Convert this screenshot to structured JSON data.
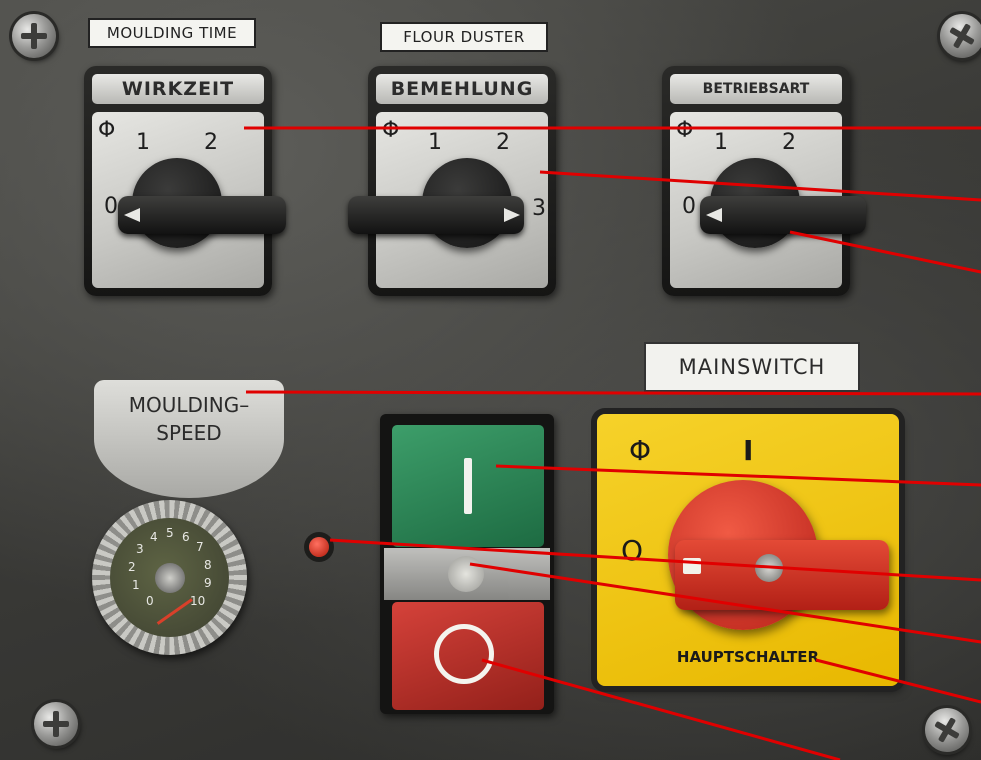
{
  "labels": {
    "moulding_time": "MOULDING TIME",
    "flour_duster": "FLOUR DUSTER"
  },
  "switches": [
    {
      "name": "WIRKZEIT",
      "phase": "Φ",
      "p0": "0",
      "p1": "1",
      "p2": "2"
    },
    {
      "name": "BEMEHLUNG",
      "phase": "Φ",
      "p1": "1",
      "p2": "2",
      "p3": "3"
    },
    {
      "name": "BETRIEBSART",
      "phase": "Φ",
      "p0": "0",
      "p1": "1",
      "p2": "2"
    }
  ],
  "moulding_speed": {
    "line1": "MOULDING–",
    "line2": "SPEED",
    "dial_numbers": [
      "0",
      "1",
      "2",
      "3",
      "4",
      "5",
      "6",
      "7",
      "8",
      "9",
      "10"
    ]
  },
  "main_switch": {
    "label": "MAINSWITCH",
    "phase": "Φ",
    "on_mark": "I",
    "off_mark": "O",
    "caption": "HAUPTSCHALTER"
  },
  "colors": {
    "panel": "#3a3a37",
    "yellow_plate": "#f1c816",
    "red_knob": "#d8301f",
    "green_button": "#2e8a58",
    "red_button": "#c0322a",
    "callout_lines": "#e00000"
  },
  "icons": [
    "screw-icon",
    "indicator-led-icon",
    "on-button-bar-icon",
    "off-button-ring-icon"
  ]
}
